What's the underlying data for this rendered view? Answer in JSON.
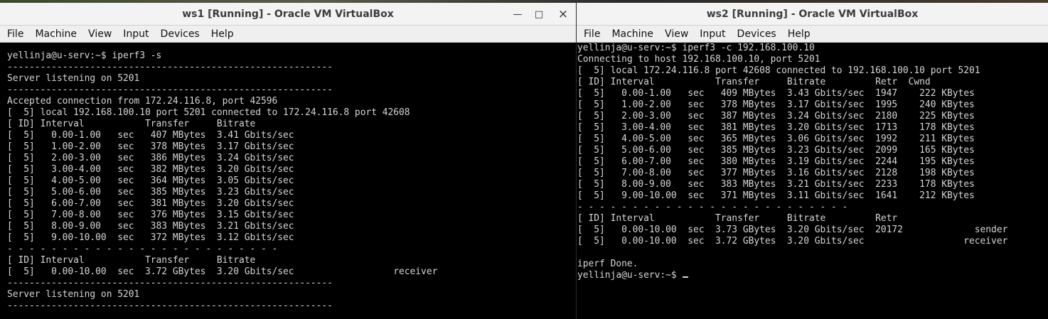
{
  "windows": [
    {
      "title": "ws1 [Running] - Oracle VM VirtualBox",
      "menu": [
        "File",
        "Machine",
        "View",
        "Input",
        "Devices",
        "Help"
      ],
      "controls": {
        "minimize": "—",
        "maximize": "□",
        "close": "×"
      },
      "console_lines": [
        "yellinja@u-serv:~$ iperf3 -s",
        "-----------------------------------------------------------",
        "Server listening on 5201",
        "-----------------------------------------------------------",
        "Accepted connection from 172.24.116.8, port 42596",
        "[  5] local 192.168.100.10 port 5201 connected to 172.24.116.8 port 42608",
        "[ ID] Interval           Transfer     Bitrate",
        "[  5]   0.00-1.00   sec   407 MBytes  3.41 Gbits/sec",
        "[  5]   1.00-2.00   sec   378 MBytes  3.17 Gbits/sec",
        "[  5]   2.00-3.00   sec   386 MBytes  3.24 Gbits/sec",
        "[  5]   3.00-4.00   sec   382 MBytes  3.20 Gbits/sec",
        "[  5]   4.00-5.00   sec   364 MBytes  3.05 Gbits/sec",
        "[  5]   5.00-6.00   sec   385 MBytes  3.23 Gbits/sec",
        "[  5]   6.00-7.00   sec   381 MBytes  3.20 Gbits/sec",
        "[  5]   7.00-8.00   sec   376 MBytes  3.15 Gbits/sec",
        "[  5]   8.00-9.00   sec   383 MBytes  3.21 Gbits/sec",
        "[  5]   9.00-10.00  sec   372 MBytes  3.12 Gbits/sec",
        "- - - - - - - - - - - - - - - - - - - - - - - - -",
        "[ ID] Interval           Transfer     Bitrate",
        "[  5]   0.00-10.00  sec  3.72 GBytes  3.20 Gbits/sec                  receiver",
        "-----------------------------------------------------------",
        "Server listening on 5201",
        "-----------------------------------------------------------"
      ]
    },
    {
      "title": "ws2 [Running] - Oracle VM VirtualBox",
      "menu": [
        "File",
        "Machine",
        "View",
        "Input",
        "Devices",
        "Help"
      ],
      "console_lines": [
        "yellinja@u-serv:~$ iperf3 -c 192.168.100.10",
        "Connecting to host 192.168.100.10, port 5201",
        "[  5] local 172.24.116.8 port 42608 connected to 192.168.100.10 port 5201",
        "[ ID] Interval           Transfer     Bitrate         Retr  Cwnd",
        "[  5]   0.00-1.00   sec   409 MBytes  3.43 Gbits/sec  1947    222 KBytes",
        "[  5]   1.00-2.00   sec   378 MBytes  3.17 Gbits/sec  1995    240 KBytes",
        "[  5]   2.00-3.00   sec   387 MBytes  3.24 Gbits/sec  2180    225 KBytes",
        "[  5]   3.00-4.00   sec   381 MBytes  3.20 Gbits/sec  1713    178 KBytes",
        "[  5]   4.00-5.00   sec   365 MBytes  3.06 Gbits/sec  1992    211 KBytes",
        "[  5]   5.00-6.00   sec   385 MBytes  3.23 Gbits/sec  2099    165 KBytes",
        "[  5]   6.00-7.00   sec   380 MBytes  3.19 Gbits/sec  2244    195 KBytes",
        "[  5]   7.00-8.00   sec   377 MBytes  3.16 Gbits/sec  2128    198 KBytes",
        "[  5]   8.00-9.00   sec   383 MBytes  3.21 Gbits/sec  2233    178 KBytes",
        "[  5]   9.00-10.00  sec   371 MBytes  3.11 Gbits/sec  1641    212 KBytes",
        "- - - - - - - - - - - - - - - - - - - - - - - - -",
        "[ ID] Interval           Transfer     Bitrate         Retr",
        "[  5]   0.00-10.00  sec  3.73 GBytes  3.20 Gbits/sec  20172             sender",
        "[  5]   0.00-10.00  sec  3.72 GBytes  3.20 Gbits/sec                  receiver",
        "",
        "iperf Done.",
        "yellinja@u-serv:~$ "
      ]
    }
  ]
}
